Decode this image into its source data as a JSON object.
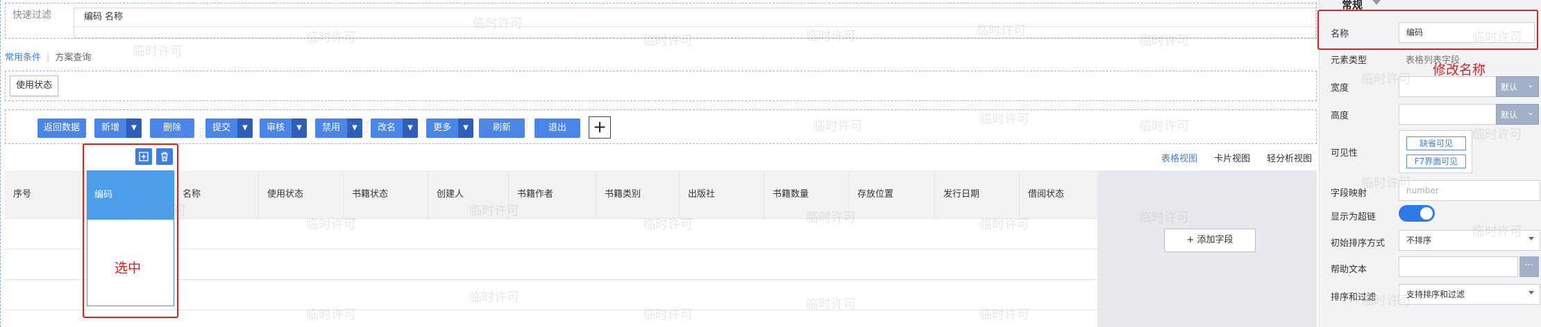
{
  "quick_filter": {
    "label": "快速过滤",
    "chips": [
      "编码",
      "名称"
    ]
  },
  "condition_tabs": {
    "common": "常用条件",
    "plan": "方案查询"
  },
  "conditions": {
    "status_filter": "使用状态"
  },
  "toolbar": {
    "back": "返回数据",
    "add": "新增",
    "delete": "删除",
    "submit": "提交",
    "audit": "审核",
    "disable": "禁用",
    "rename": "改名",
    "more": "更多",
    "refresh": "刷新",
    "exit": "退出",
    "plus": "+"
  },
  "views": {
    "table": "表格视图",
    "card": "卡片视图",
    "analysis": "轻分析视图"
  },
  "grid": {
    "columns": [
      "序号",
      "编码",
      "名称",
      "使用状态",
      "书籍状态",
      "创建人",
      "书籍作者",
      "书籍类别",
      "出版社",
      "书籍数量",
      "存放位置",
      "发行日期",
      "借阅状态"
    ],
    "add_field": "+ 添加字段"
  },
  "annotations": {
    "selected": "选中",
    "rename_hint": "修改名称"
  },
  "watermark": "临时许可",
  "properties": {
    "section_title": "常规",
    "name_label": "名称",
    "name_value": "编码",
    "element_type_label": "元素类型",
    "element_type_value": "表格列表字段",
    "width_label": "宽度",
    "width_select": "默认",
    "height_label": "高度",
    "height_select": "默认",
    "visibility_label": "可见性",
    "visibility_tags": [
      "缺省可见",
      "F7界面可见"
    ],
    "field_mapping_label": "字段映射",
    "field_mapping_placeholder": "number",
    "show_hyperlink_label": "显示为超链",
    "sort_label": "初始排序方式",
    "sort_value": "不排序",
    "help_label": "帮助文本",
    "help_more": "···",
    "sort_filter_label": "排序和过滤",
    "sort_filter_value": "支持排序和过滤"
  }
}
